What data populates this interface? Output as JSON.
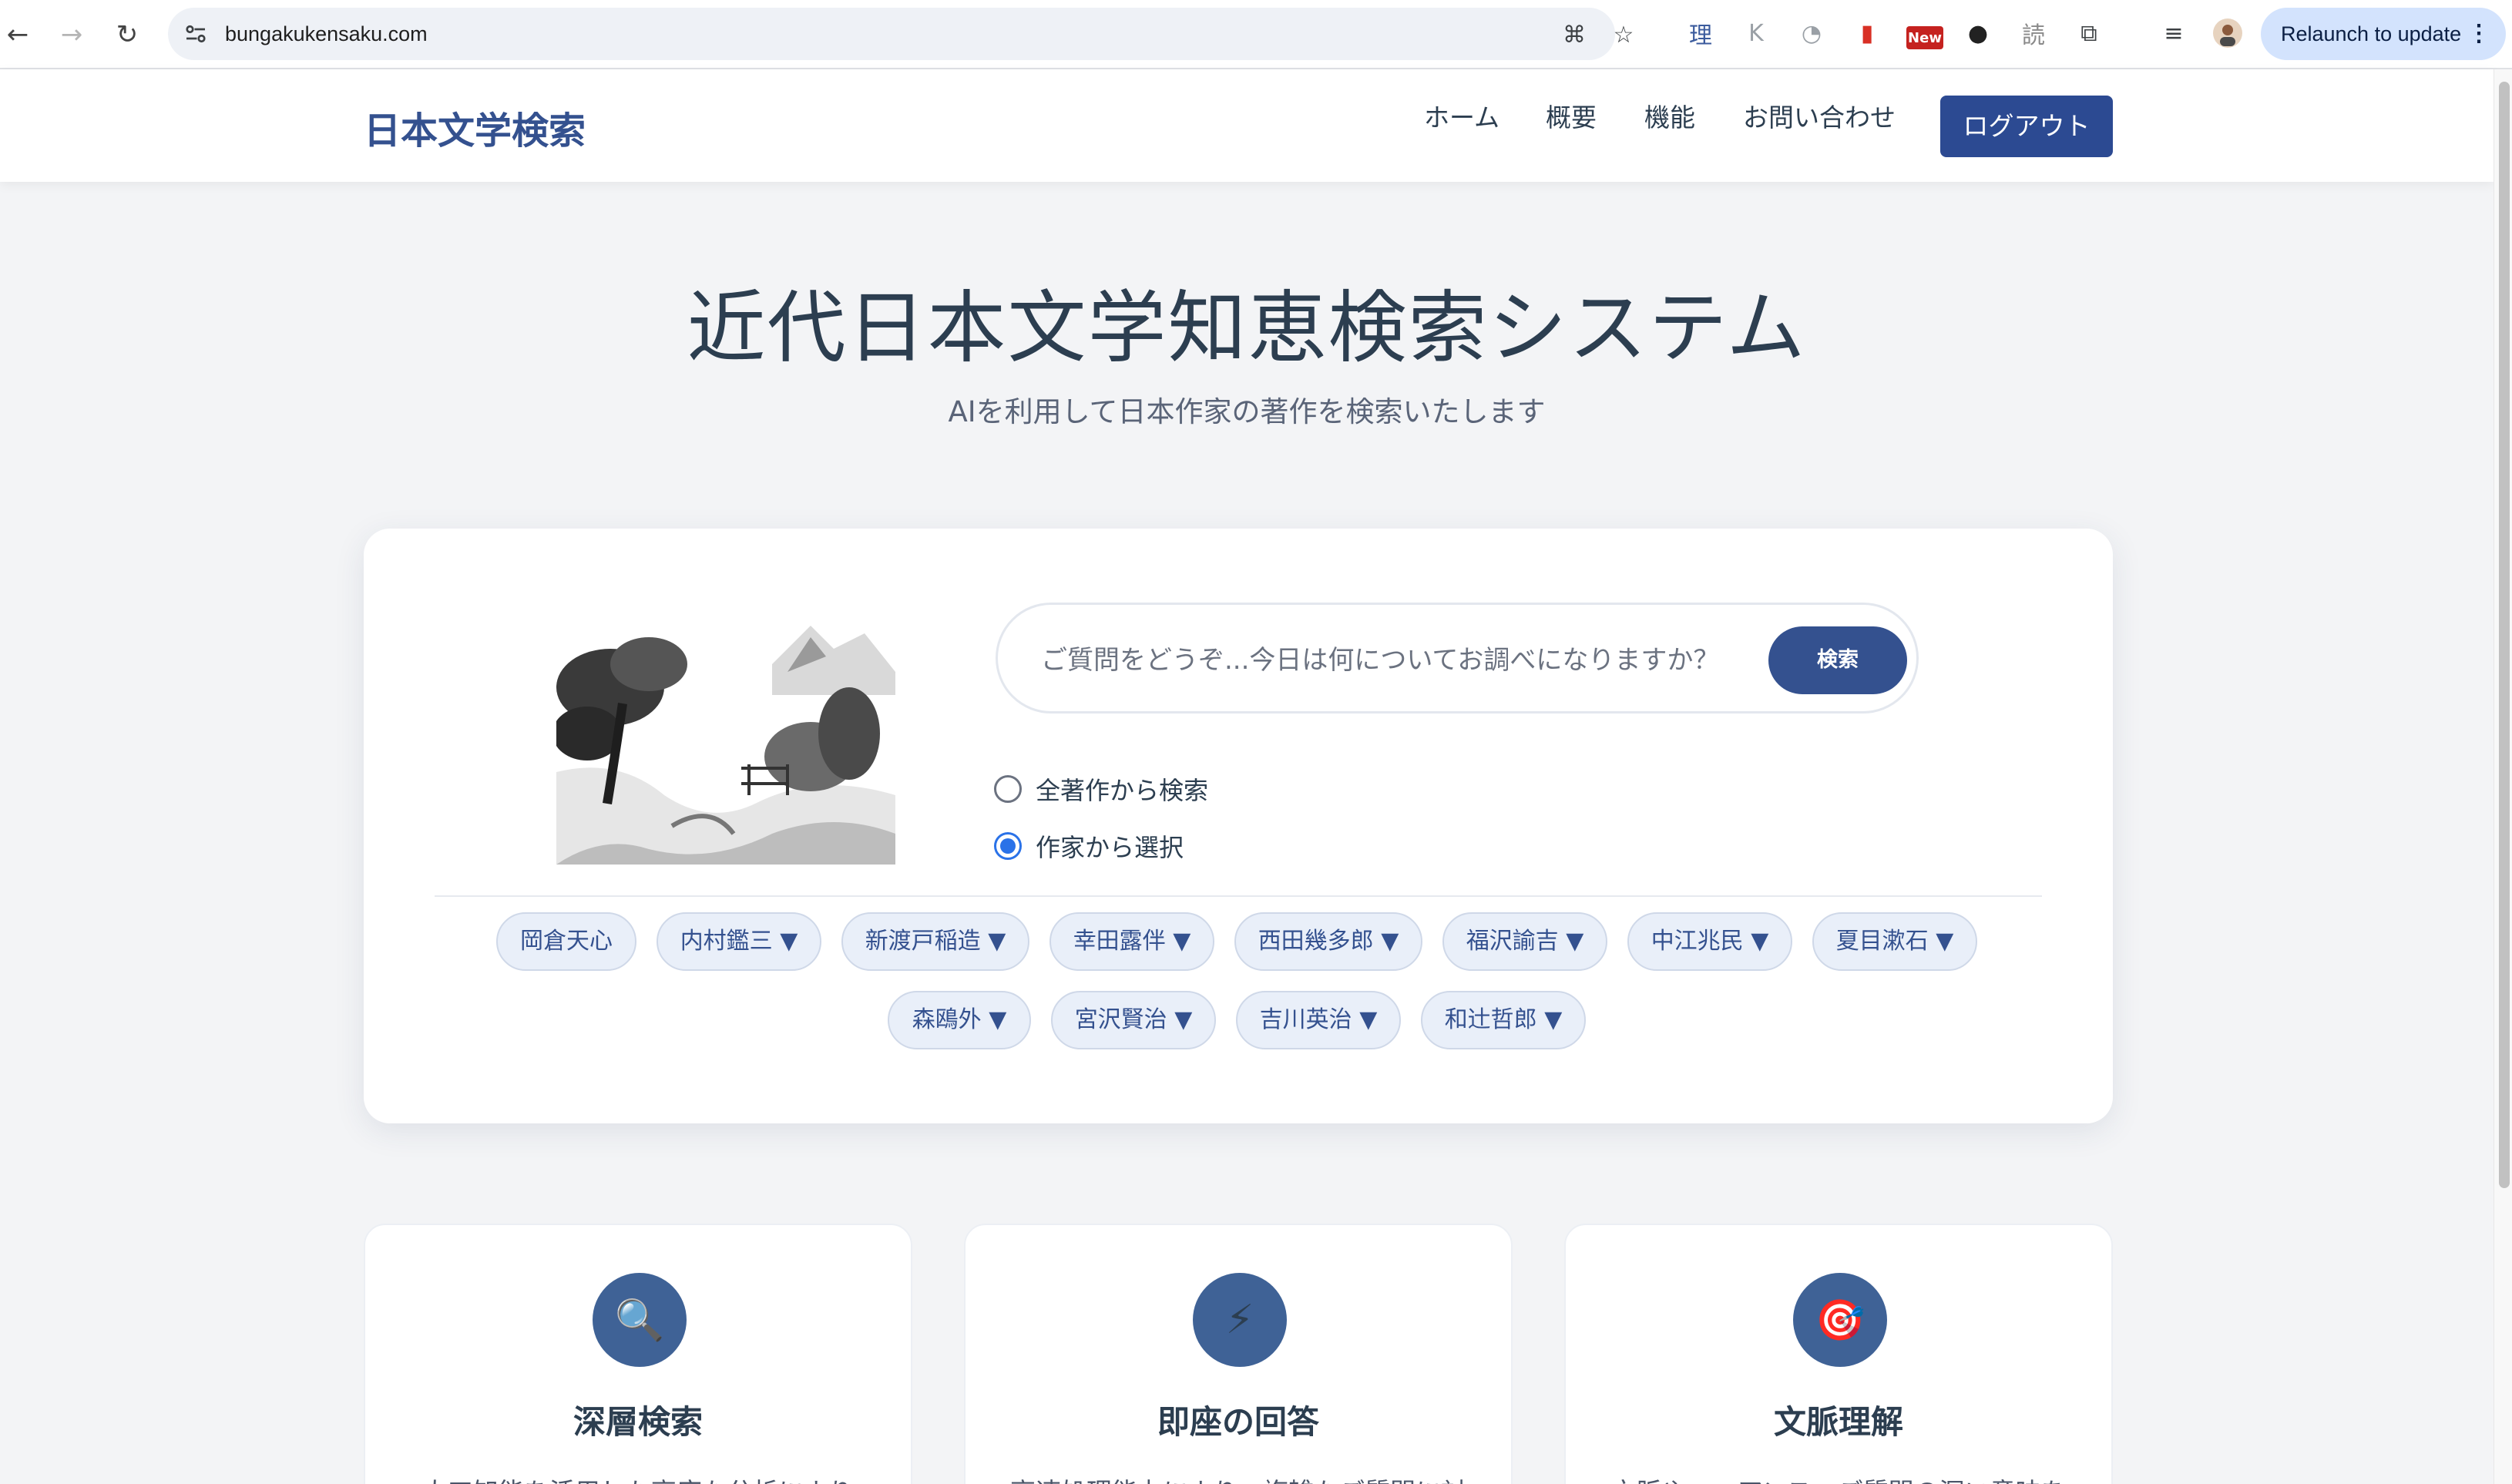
{
  "browser": {
    "url": "bungakukensaku.com",
    "relaunch_label": "Relaunch to update",
    "extensions": [
      {
        "name": "ri-extension-icon",
        "glyph": "理",
        "color": "#3b5b9d"
      },
      {
        "name": "kanji-extension-icon",
        "glyph": "K",
        "color": "#9aa0a6"
      },
      {
        "name": "brain-extension-icon",
        "glyph": "◔",
        "color": "#9aa0a6"
      },
      {
        "name": "pdf-extension-icon",
        "glyph": "▮",
        "color": "#d93025"
      },
      {
        "name": "new-badge-extension-icon",
        "glyph": "New",
        "color": "#c5221f"
      },
      {
        "name": "spy-extension-icon",
        "glyph": "●",
        "color": "#222"
      },
      {
        "name": "reading-extension-icon",
        "glyph": "読",
        "color": "#8a8a8a"
      },
      {
        "name": "puzzle-extension-icon",
        "glyph": "⧉",
        "color": "#3c4043"
      }
    ]
  },
  "site": {
    "logo": "日本文学検索",
    "nav": [
      "ホーム",
      "概要",
      "機能",
      "お問い合わせ"
    ],
    "logout": "ログアウト"
  },
  "hero": {
    "title": "近代日本文学知恵検索システム",
    "subtitle": "AIを利用して日本作家の著作を検索いたします"
  },
  "search": {
    "placeholder": "ご質問をどうぞ...今日は何についてお調べになりますか？",
    "value": "",
    "button": "検索",
    "options": [
      {
        "label": "全著作から検索",
        "checked": false
      },
      {
        "label": "作家から選択",
        "checked": true
      }
    ]
  },
  "authors_row1": [
    "岡倉天心",
    "内村鑑三 ▼",
    "新渡戸稲造 ▼",
    "幸田露伴 ▼",
    "西田幾多郎 ▼",
    "福沢諭吉 ▼",
    "中江兆民 ▼",
    "夏目漱石 ▼"
  ],
  "authors_row2": [
    "森鴎外 ▼",
    "宮沢賢治 ▼",
    "吉川英治 ▼",
    "和辻哲郎 ▼"
  ],
  "features": [
    {
      "icon": "magnifier-icon",
      "glyph": "🔍",
      "title": "深層検索",
      "desc": "人工知能を活用した高度な分析により"
    },
    {
      "icon": "lightning-icon",
      "glyph": "⚡",
      "title": "即座の回答",
      "desc": "高速処理能力により、複雑なご質問に対"
    },
    {
      "icon": "target-icon",
      "glyph": "🎯",
      "title": "文脈理解",
      "desc": "文脈やニュアンス、ご質問の深い意味を"
    }
  ]
}
